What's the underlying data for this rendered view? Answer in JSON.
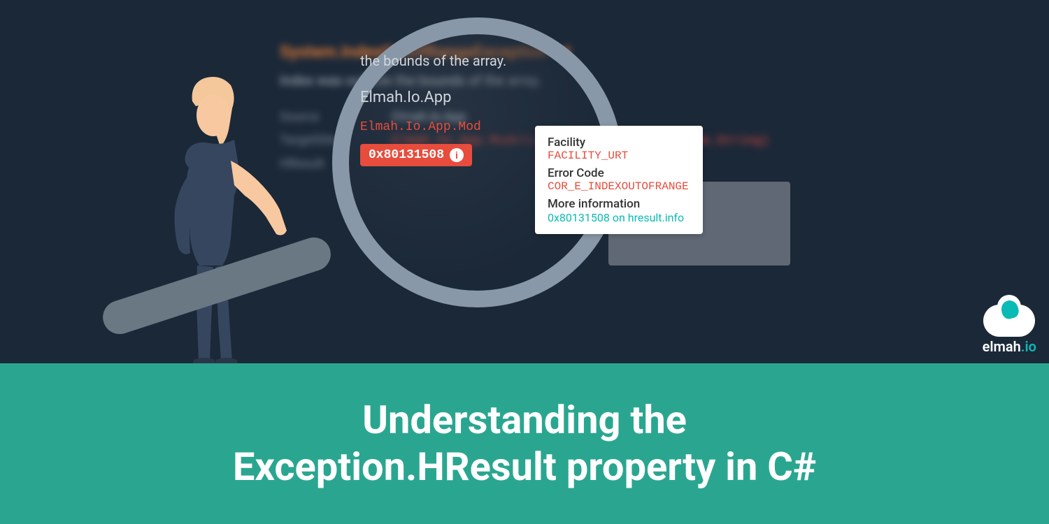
{
  "exception": {
    "title": "System.IndexOutOfRangeException",
    "message": "Index was outside the bounds of the array.",
    "labels": {
      "source": "Source",
      "targetSite": "TargetSite",
      "hresult": "HResult"
    },
    "values": {
      "source": "Elmah.Io.App",
      "targetSite": "Elmah.Io.App.Models.ParseParameters(System.String)"
    }
  },
  "lens": {
    "boundsText": "the bounds of the array.",
    "app": "Elmah.Io.App",
    "targetSitePartial": "Elmah.Io.App.Mod",
    "hresultBadge": "0x80131508"
  },
  "tooltip": {
    "facilityLabel": "Facility",
    "facilityValue": "FACILITY_URT",
    "errorCodeLabel": "Error Code",
    "errorCodeValue": "COR_E_INDEXOUTOFRANGE",
    "moreInfoLabel": "More information",
    "moreInfoLink": "0x80131508 on hresult.info"
  },
  "logo": {
    "brand": "elmah",
    ".suffix": ".io"
  },
  "headline": {
    "line1": "Understanding the",
    "line2": "Exception.HResult property in C#"
  }
}
